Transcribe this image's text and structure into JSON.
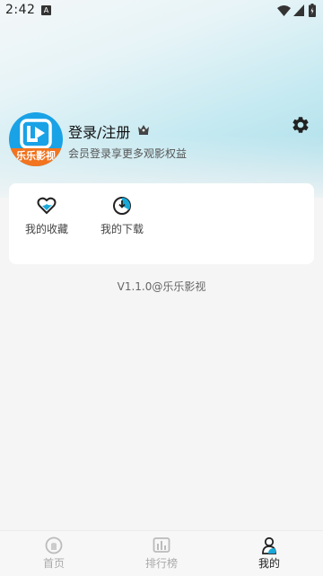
{
  "status_bar": {
    "time": "2:42",
    "badge": "A",
    "icons": [
      "wifi-icon",
      "signal-icon",
      "battery-icon"
    ]
  },
  "profile": {
    "avatar_text": "乐乐影视",
    "login_title": "登录/注册",
    "crown_icon": "crown-icon",
    "subtitle": "会员登录享更多观影权益",
    "settings_icon": "gear-icon"
  },
  "quick_actions": [
    {
      "label": "我的收藏",
      "icon": "heart-icon"
    },
    {
      "label": "我的下载",
      "icon": "download-icon"
    }
  ],
  "version": "V1.1.0@乐乐影视",
  "bottom_nav": [
    {
      "label": "首页",
      "icon": "home-icon",
      "active": false
    },
    {
      "label": "排行榜",
      "icon": "ranking-icon",
      "active": false
    },
    {
      "label": "我的",
      "icon": "profile-icon",
      "active": true
    }
  ],
  "colors": {
    "accent": "#1aa2e6",
    "avatar_banner": "#f2741f",
    "background": "#f5f5f5"
  }
}
